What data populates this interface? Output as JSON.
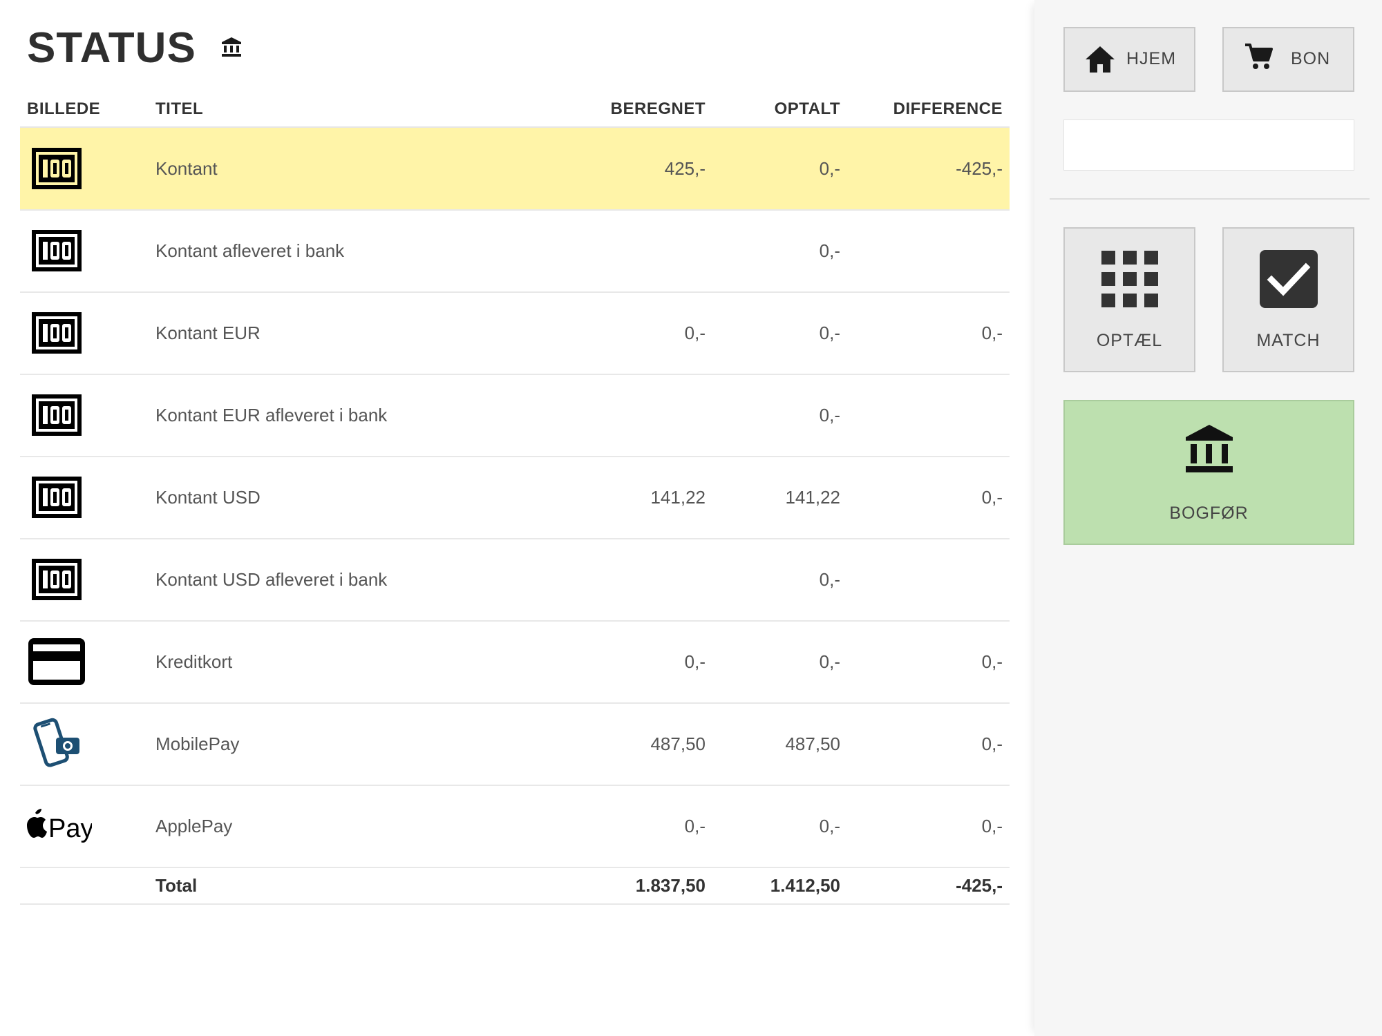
{
  "page": {
    "title": "STATUS",
    "title_icon": "bank-icon"
  },
  "table": {
    "headers": {
      "image": "BILLEDE",
      "title": "TITEL",
      "calculated": "BEREGNET",
      "counted": "OPTALT",
      "difference": "DIFFERENCE"
    },
    "rows": [
      {
        "icon": "cash-icon",
        "title": "Kontant",
        "calculated": "425,-",
        "counted": "0,-",
        "difference": "-425,-",
        "highlighted": true
      },
      {
        "icon": "cash-icon",
        "title": "Kontant afleveret i bank",
        "calculated": "",
        "counted": "0,-",
        "difference": ""
      },
      {
        "icon": "cash-icon",
        "title": "Kontant EUR",
        "calculated": "0,-",
        "counted": "0,-",
        "difference": "0,-"
      },
      {
        "icon": "cash-icon",
        "title": "Kontant EUR afleveret i bank",
        "calculated": "",
        "counted": "0,-",
        "difference": ""
      },
      {
        "icon": "cash-icon",
        "title": "Kontant USD",
        "calculated": "141,22",
        "counted": "141,22",
        "difference": "0,-"
      },
      {
        "icon": "cash-icon",
        "title": "Kontant USD afleveret i bank",
        "calculated": "",
        "counted": "0,-",
        "difference": ""
      },
      {
        "icon": "credit-card-icon",
        "title": "Kreditkort",
        "calculated": "0,-",
        "counted": "0,-",
        "difference": "0,-"
      },
      {
        "icon": "mobilepay-icon",
        "title": "MobilePay",
        "calculated": "487,50",
        "counted": "487,50",
        "difference": "0,-"
      },
      {
        "icon": "applepay-icon",
        "title": "ApplePay",
        "calculated": "0,-",
        "counted": "0,-",
        "difference": "0,-"
      }
    ],
    "total": {
      "label": "Total",
      "calculated": "1.837,50",
      "counted": "1.412,50",
      "difference": "-425,-"
    }
  },
  "applepay_logo": {
    "text": "Pay"
  },
  "sidebar": {
    "home_label": "HJEM",
    "receipt_label": "BON",
    "search": {
      "value": "",
      "placeholder": ""
    },
    "count_label": "OPTÆL",
    "match_label": "MATCH",
    "post_label": "BOGFØR"
  },
  "colors": {
    "highlight_row": "#fff4a8",
    "post_button": "#bde0af",
    "button_bg": "#e8e8e8",
    "sidebar_bg": "#f6f6f6",
    "mobilepay_blue": "#1d4f73"
  }
}
